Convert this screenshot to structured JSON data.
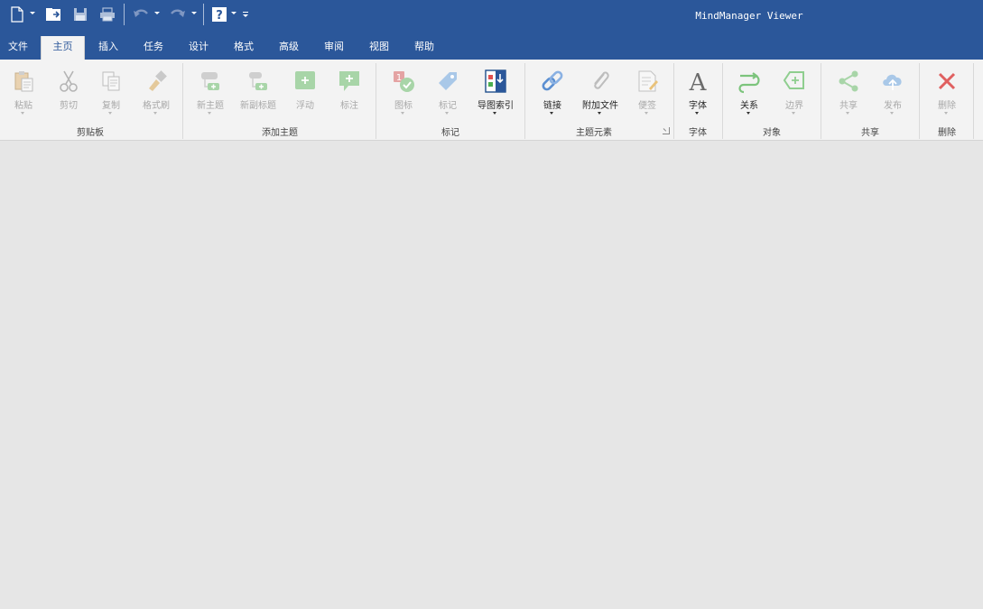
{
  "app": {
    "title": "MindManager Viewer"
  },
  "quick_access": [
    "new-file-icon",
    "open-icon",
    "save-icon",
    "print-icon",
    "undo-icon",
    "redo-icon",
    "help-icon",
    "customize-icon"
  ],
  "tabs": [
    {
      "label": "文件"
    },
    {
      "label": "主页"
    },
    {
      "label": "插入"
    },
    {
      "label": "任务"
    },
    {
      "label": "设计"
    },
    {
      "label": "格式"
    },
    {
      "label": "高级"
    },
    {
      "label": "审阅"
    },
    {
      "label": "视图"
    },
    {
      "label": "帮助"
    }
  ],
  "active_tab": "主页",
  "ribbon": {
    "clipboard": {
      "group": "剪贴板",
      "paste": "粘贴",
      "cut": "剪切",
      "copy": "复制",
      "format_painter": "格式刷"
    },
    "add_topic": {
      "group": "添加主题",
      "new_topic": "新主题",
      "new_subtopic": "新副标题",
      "floating": "浮动",
      "callout": "标注"
    },
    "markers": {
      "group": "标记",
      "icons": "图标",
      "tags": "标记",
      "map_index": "导图索引"
    },
    "topic_elements": {
      "group": "主题元素",
      "link": "链接",
      "attachment": "附加文件",
      "notes": "便签"
    },
    "font": {
      "group": "字体",
      "font": "字体"
    },
    "objects": {
      "group": "对象",
      "relationship": "关系",
      "boundary": "边界"
    },
    "share": {
      "group": "共享",
      "share": "共享",
      "publish": "发布"
    },
    "delete": {
      "group": "删除",
      "delete": "删除"
    }
  },
  "colors": {
    "titlebar": "#2b579a",
    "ribbon": "#f3f3f3",
    "workspace": "#e6e6e6",
    "disabled_text": "#a8a8a8"
  }
}
